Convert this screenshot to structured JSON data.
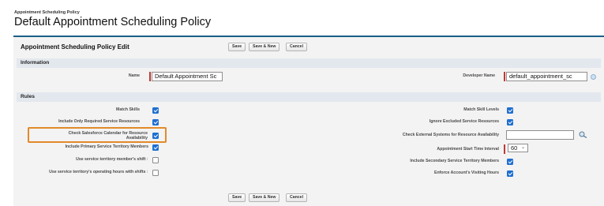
{
  "header": {
    "breadcrumb": "Appointment Scheduling Policy",
    "title": "Default Appointment Scheduling Policy"
  },
  "panel": {
    "title": "Appointment Scheduling Policy Edit",
    "buttons": {
      "save": "Save",
      "save_new": "Save & New",
      "cancel": "Cancel"
    }
  },
  "information": {
    "heading": "Information",
    "name_label": "Name",
    "name_value": "Default Appointment Sc",
    "developer_name_label": "Developer Name",
    "developer_name_value": "default_appointment_sc"
  },
  "rules": {
    "heading": "Rules",
    "left": [
      {
        "label": "Match Skills",
        "checked": true
      },
      {
        "label": "Include Only Required Service Resources",
        "checked": true
      },
      {
        "label": "Check Salesforce Calendar for Resource",
        "label2": "Availability",
        "checked": true
      },
      {
        "label": "Include Primary Service Territory Members",
        "checked": true
      },
      {
        "label": "Use service territory member's shift",
        "checked": false,
        "help": "i"
      },
      {
        "label": "Use service territory's operating hours with shifts",
        "checked": false,
        "help": "i"
      }
    ],
    "right": [
      {
        "label": "Match Skill Levels",
        "checked": true
      },
      {
        "label": "Ignore Excluded Service Resources",
        "checked": true
      },
      {
        "label": "Check External Systems for Resource Availability",
        "value": ""
      },
      {
        "label": "Appointment Start Time Interval",
        "value": "60"
      },
      {
        "label": "Include Secondary Service Territory Members",
        "checked": true
      },
      {
        "label": "Enforce Account's Visiting Hours",
        "checked": true
      }
    ]
  },
  "colors": {
    "accent": "#1a5f88",
    "checkbox": "#1f6fd1",
    "highlight": "#e28a2a",
    "required": "#c23934"
  }
}
